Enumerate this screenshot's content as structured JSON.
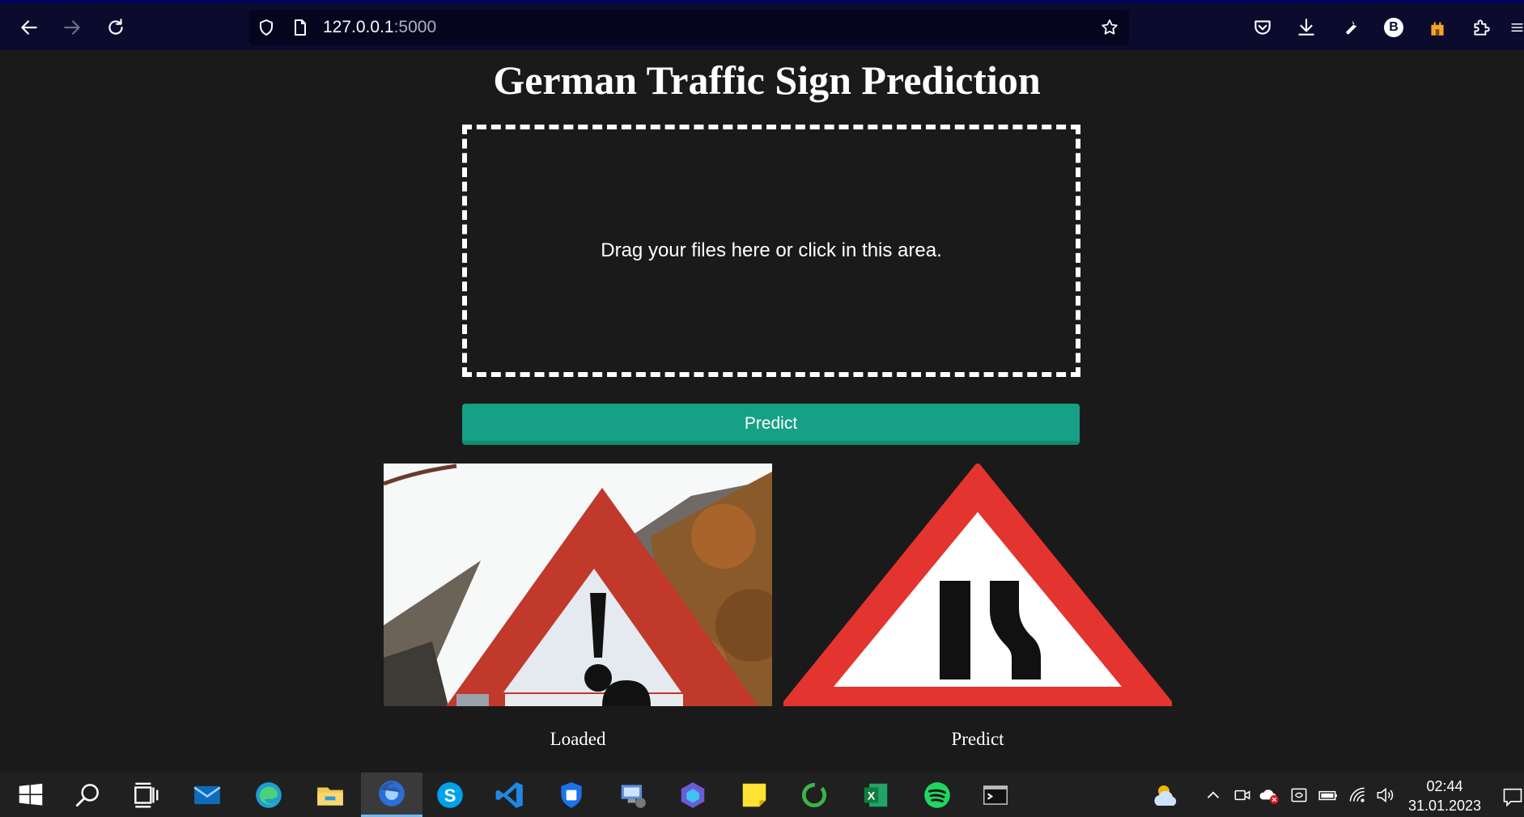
{
  "browser": {
    "url_host": "127.0.0.1",
    "url_port": ":5000",
    "profile_initial": "B"
  },
  "page": {
    "title": "German Traffic Sign Prediction",
    "drop_zone_text": "Drag your files here or click in this area.",
    "predict_button_label": "Predict",
    "loaded_caption": "Loaded",
    "predict_caption": "Predict"
  },
  "taskbar": {
    "apps": [
      "start",
      "search",
      "task-view",
      "mail",
      "edge",
      "file-explorer",
      "firefox",
      "skype",
      "vscode",
      "security",
      "remote-desktop",
      "copilot",
      "sticky-notes",
      "circle-app",
      "excel",
      "spotify",
      "terminal"
    ],
    "active_app": "firefox",
    "time": "02:44",
    "date": "31.01.2023"
  },
  "colors": {
    "accent_button": "#16a085",
    "browser_bar": "#0b0b2e",
    "page_background": "#1a1a1a",
    "taskbar": "#202020"
  }
}
